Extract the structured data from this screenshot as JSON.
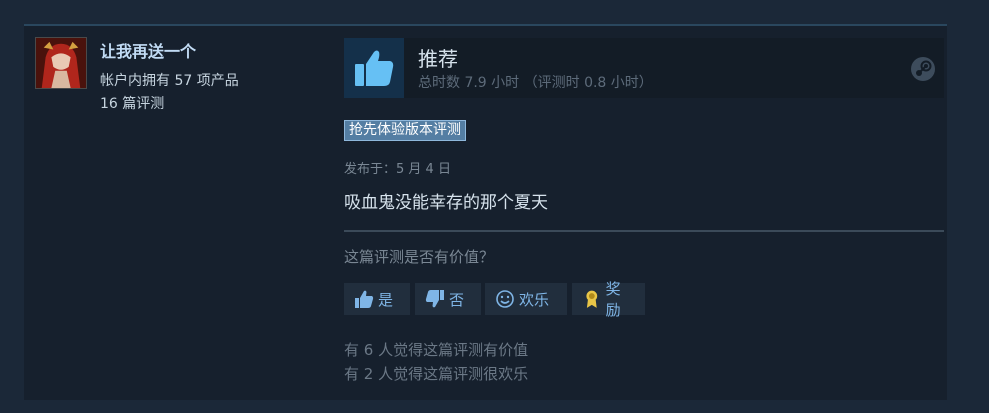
{
  "author": {
    "name": "让我再送一个",
    "products": "帐户内拥有 57 项产品",
    "reviews": "16 篇评测"
  },
  "review": {
    "verdict": "推荐",
    "hours": "总时数 7.9 小时  （评测时 0.8 小时）",
    "badge": "抢先体验版本评测",
    "posted": "发布于：5 月 4 日",
    "text": "吸血鬼没能幸存的那个夏天"
  },
  "feedback": {
    "question": "这篇评测是否有价值？",
    "yes_label": "是",
    "no_label": "否",
    "funny_label": "欢乐",
    "award_label": "奖励",
    "helpful_count": "有 6 人觉得这篇评测有价值",
    "funny_count": "有 2 人觉得这篇评测很欢乐"
  },
  "icons": {
    "thumb": "thumbs-up-icon",
    "platform": "steam-icon",
    "funny": "smiley-icon",
    "award": "award-icon"
  },
  "colors": {
    "background": "#1b2838",
    "card": "#16202d",
    "accent_blue": "#7fb5e6",
    "author_name": "#c1dbf4",
    "badge": "#547ea3"
  }
}
